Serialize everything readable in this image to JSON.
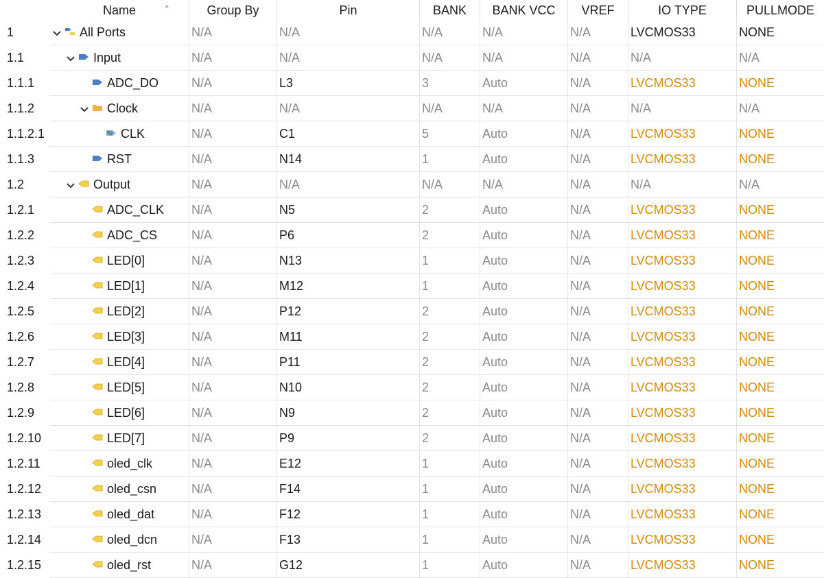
{
  "columns": {
    "name": "Name",
    "group_by": "Group By",
    "pin": "Pin",
    "bank": "BANK",
    "bank_vcc": "BANK VCC",
    "vref": "VREF",
    "io_type": "IO TYPE",
    "pullmode": "PULLMODE"
  },
  "colors": {
    "accent_orange": "#d08a10",
    "na_gray": "#8a8a8a",
    "input_blue": "#4a7fc1",
    "output_yellow": "#f3d24a",
    "folder_orange": "#f0b43a"
  },
  "rows": [
    {
      "idx": "1",
      "level": 0,
      "toggle": "expanded",
      "icon": "all-ports-icon",
      "name": "All Ports",
      "group_by": "N/A",
      "pin": "N/A",
      "bank": "N/A",
      "bank_vcc": "N/A",
      "vref": "N/A",
      "io_type": "LVCMOS33",
      "pullmode": "NONE",
      "kind": "root"
    },
    {
      "idx": "1.1",
      "level": 1,
      "toggle": "expanded",
      "icon": "input-port-icon",
      "name": "Input",
      "group_by": "N/A",
      "pin": "N/A",
      "bank": "N/A",
      "bank_vcc": "N/A",
      "vref": "N/A",
      "io_type": "N/A",
      "pullmode": "N/A",
      "kind": "group"
    },
    {
      "idx": "1.1.1",
      "level": 2,
      "toggle": "",
      "icon": "input-port-icon",
      "name": "ADC_DO",
      "group_by": "N/A",
      "pin": "L3",
      "bank": "3",
      "bank_vcc": "Auto",
      "vref": "N/A",
      "io_type": "LVCMOS33",
      "pullmode": "NONE",
      "kind": "port"
    },
    {
      "idx": "1.1.2",
      "level": 2,
      "toggle": "expanded",
      "icon": "folder-icon",
      "name": "Clock",
      "group_by": "N/A",
      "pin": "N/A",
      "bank": "N/A",
      "bank_vcc": "N/A",
      "vref": "N/A",
      "io_type": "N/A",
      "pullmode": "N/A",
      "kind": "group"
    },
    {
      "idx": "1.1.2.1",
      "level": 3,
      "toggle": "",
      "icon": "clock-port-icon",
      "name": "CLK",
      "group_by": "N/A",
      "pin": "C1",
      "bank": "5",
      "bank_vcc": "Auto",
      "vref": "N/A",
      "io_type": "LVCMOS33",
      "pullmode": "NONE",
      "kind": "port"
    },
    {
      "idx": "1.1.3",
      "level": 2,
      "toggle": "",
      "icon": "input-port-icon",
      "name": "RST",
      "group_by": "N/A",
      "pin": "N14",
      "bank": "1",
      "bank_vcc": "Auto",
      "vref": "N/A",
      "io_type": "LVCMOS33",
      "pullmode": "NONE",
      "kind": "port"
    },
    {
      "idx": "1.2",
      "level": 1,
      "toggle": "expanded",
      "icon": "output-port-icon",
      "name": "Output",
      "group_by": "N/A",
      "pin": "N/A",
      "bank": "N/A",
      "bank_vcc": "N/A",
      "vref": "N/A",
      "io_type": "N/A",
      "pullmode": "N/A",
      "kind": "group"
    },
    {
      "idx": "1.2.1",
      "level": 2,
      "toggle": "",
      "icon": "output-port-icon",
      "name": "ADC_CLK",
      "group_by": "N/A",
      "pin": "N5",
      "bank": "2",
      "bank_vcc": "Auto",
      "vref": "N/A",
      "io_type": "LVCMOS33",
      "pullmode": "NONE",
      "kind": "port"
    },
    {
      "idx": "1.2.2",
      "level": 2,
      "toggle": "",
      "icon": "output-port-icon",
      "name": "ADC_CS",
      "group_by": "N/A",
      "pin": "P6",
      "bank": "2",
      "bank_vcc": "Auto",
      "vref": "N/A",
      "io_type": "LVCMOS33",
      "pullmode": "NONE",
      "kind": "port"
    },
    {
      "idx": "1.2.3",
      "level": 2,
      "toggle": "",
      "icon": "output-port-icon",
      "name": "LED[0]",
      "group_by": "N/A",
      "pin": "N13",
      "bank": "1",
      "bank_vcc": "Auto",
      "vref": "N/A",
      "io_type": "LVCMOS33",
      "pullmode": "NONE",
      "kind": "port"
    },
    {
      "idx": "1.2.4",
      "level": 2,
      "toggle": "",
      "icon": "output-port-icon",
      "name": "LED[1]",
      "group_by": "N/A",
      "pin": "M12",
      "bank": "1",
      "bank_vcc": "Auto",
      "vref": "N/A",
      "io_type": "LVCMOS33",
      "pullmode": "NONE",
      "kind": "port"
    },
    {
      "idx": "1.2.5",
      "level": 2,
      "toggle": "",
      "icon": "output-port-icon",
      "name": "LED[2]",
      "group_by": "N/A",
      "pin": "P12",
      "bank": "2",
      "bank_vcc": "Auto",
      "vref": "N/A",
      "io_type": "LVCMOS33",
      "pullmode": "NONE",
      "kind": "port"
    },
    {
      "idx": "1.2.6",
      "level": 2,
      "toggle": "",
      "icon": "output-port-icon",
      "name": "LED[3]",
      "group_by": "N/A",
      "pin": "M11",
      "bank": "2",
      "bank_vcc": "Auto",
      "vref": "N/A",
      "io_type": "LVCMOS33",
      "pullmode": "NONE",
      "kind": "port"
    },
    {
      "idx": "1.2.7",
      "level": 2,
      "toggle": "",
      "icon": "output-port-icon",
      "name": "LED[4]",
      "group_by": "N/A",
      "pin": "P11",
      "bank": "2",
      "bank_vcc": "Auto",
      "vref": "N/A",
      "io_type": "LVCMOS33",
      "pullmode": "NONE",
      "kind": "port"
    },
    {
      "idx": "1.2.8",
      "level": 2,
      "toggle": "",
      "icon": "output-port-icon",
      "name": "LED[5]",
      "group_by": "N/A",
      "pin": "N10",
      "bank": "2",
      "bank_vcc": "Auto",
      "vref": "N/A",
      "io_type": "LVCMOS33",
      "pullmode": "NONE",
      "kind": "port"
    },
    {
      "idx": "1.2.9",
      "level": 2,
      "toggle": "",
      "icon": "output-port-icon",
      "name": "LED[6]",
      "group_by": "N/A",
      "pin": "N9",
      "bank": "2",
      "bank_vcc": "Auto",
      "vref": "N/A",
      "io_type": "LVCMOS33",
      "pullmode": "NONE",
      "kind": "port"
    },
    {
      "idx": "1.2.10",
      "level": 2,
      "toggle": "",
      "icon": "output-port-icon",
      "name": "LED[7]",
      "group_by": "N/A",
      "pin": "P9",
      "bank": "2",
      "bank_vcc": "Auto",
      "vref": "N/A",
      "io_type": "LVCMOS33",
      "pullmode": "NONE",
      "kind": "port"
    },
    {
      "idx": "1.2.11",
      "level": 2,
      "toggle": "",
      "icon": "output-port-icon",
      "name": "oled_clk",
      "group_by": "N/A",
      "pin": "E12",
      "bank": "1",
      "bank_vcc": "Auto",
      "vref": "N/A",
      "io_type": "LVCMOS33",
      "pullmode": "NONE",
      "kind": "port"
    },
    {
      "idx": "1.2.12",
      "level": 2,
      "toggle": "",
      "icon": "output-port-icon",
      "name": "oled_csn",
      "group_by": "N/A",
      "pin": "F14",
      "bank": "1",
      "bank_vcc": "Auto",
      "vref": "N/A",
      "io_type": "LVCMOS33",
      "pullmode": "NONE",
      "kind": "port"
    },
    {
      "idx": "1.2.13",
      "level": 2,
      "toggle": "",
      "icon": "output-port-icon",
      "name": "oled_dat",
      "group_by": "N/A",
      "pin": "F12",
      "bank": "1",
      "bank_vcc": "Auto",
      "vref": "N/A",
      "io_type": "LVCMOS33",
      "pullmode": "NONE",
      "kind": "port"
    },
    {
      "idx": "1.2.14",
      "level": 2,
      "toggle": "",
      "icon": "output-port-icon",
      "name": "oled_dcn",
      "group_by": "N/A",
      "pin": "F13",
      "bank": "1",
      "bank_vcc": "Auto",
      "vref": "N/A",
      "io_type": "LVCMOS33",
      "pullmode": "NONE",
      "kind": "port"
    },
    {
      "idx": "1.2.15",
      "level": 2,
      "toggle": "",
      "icon": "output-port-icon",
      "name": "oled_rst",
      "group_by": "N/A",
      "pin": "G12",
      "bank": "1",
      "bank_vcc": "Auto",
      "vref": "N/A",
      "io_type": "LVCMOS33",
      "pullmode": "NONE",
      "kind": "port"
    }
  ]
}
